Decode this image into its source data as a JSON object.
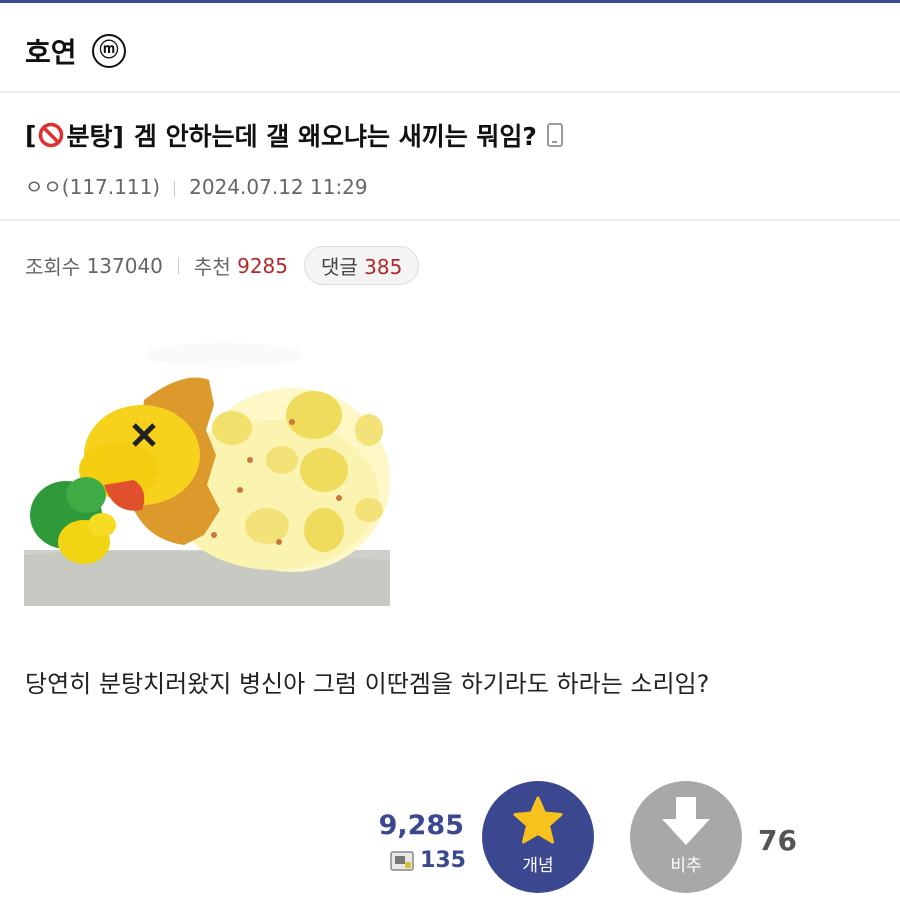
{
  "gallery": {
    "name": "호연",
    "badge": "ⓜ"
  },
  "post": {
    "title_prefix": "[",
    "title_head": "분탕]",
    "title_text": "겜 안하는데 갤 왜오냐는 새끼는 뭐임?",
    "author": "ㅇㅇ(117.111)",
    "date": "2024.07.12 11:29",
    "views_label": "조회수",
    "views": "137040",
    "recommend_label": "추천",
    "recommend": "9285",
    "comments_label": "댓글",
    "comments": "385",
    "body": "당연히 분탕치러왔지 병신아 그럼 이딴겜을 하기라도 하라는 소리임?"
  },
  "vote": {
    "up_count": "9,285",
    "fix_count": "135",
    "up_label": "개념",
    "down_label": "비추",
    "down_count": "76"
  },
  "colors": {
    "accent": "#3b4890",
    "recommend_red": "#b02a2a",
    "down_gray": "#a8a8a8"
  },
  "icons": [
    "no-entry-icon",
    "mobile-icon",
    "star-icon",
    "down-arrow-icon",
    "fix-image-icon"
  ]
}
